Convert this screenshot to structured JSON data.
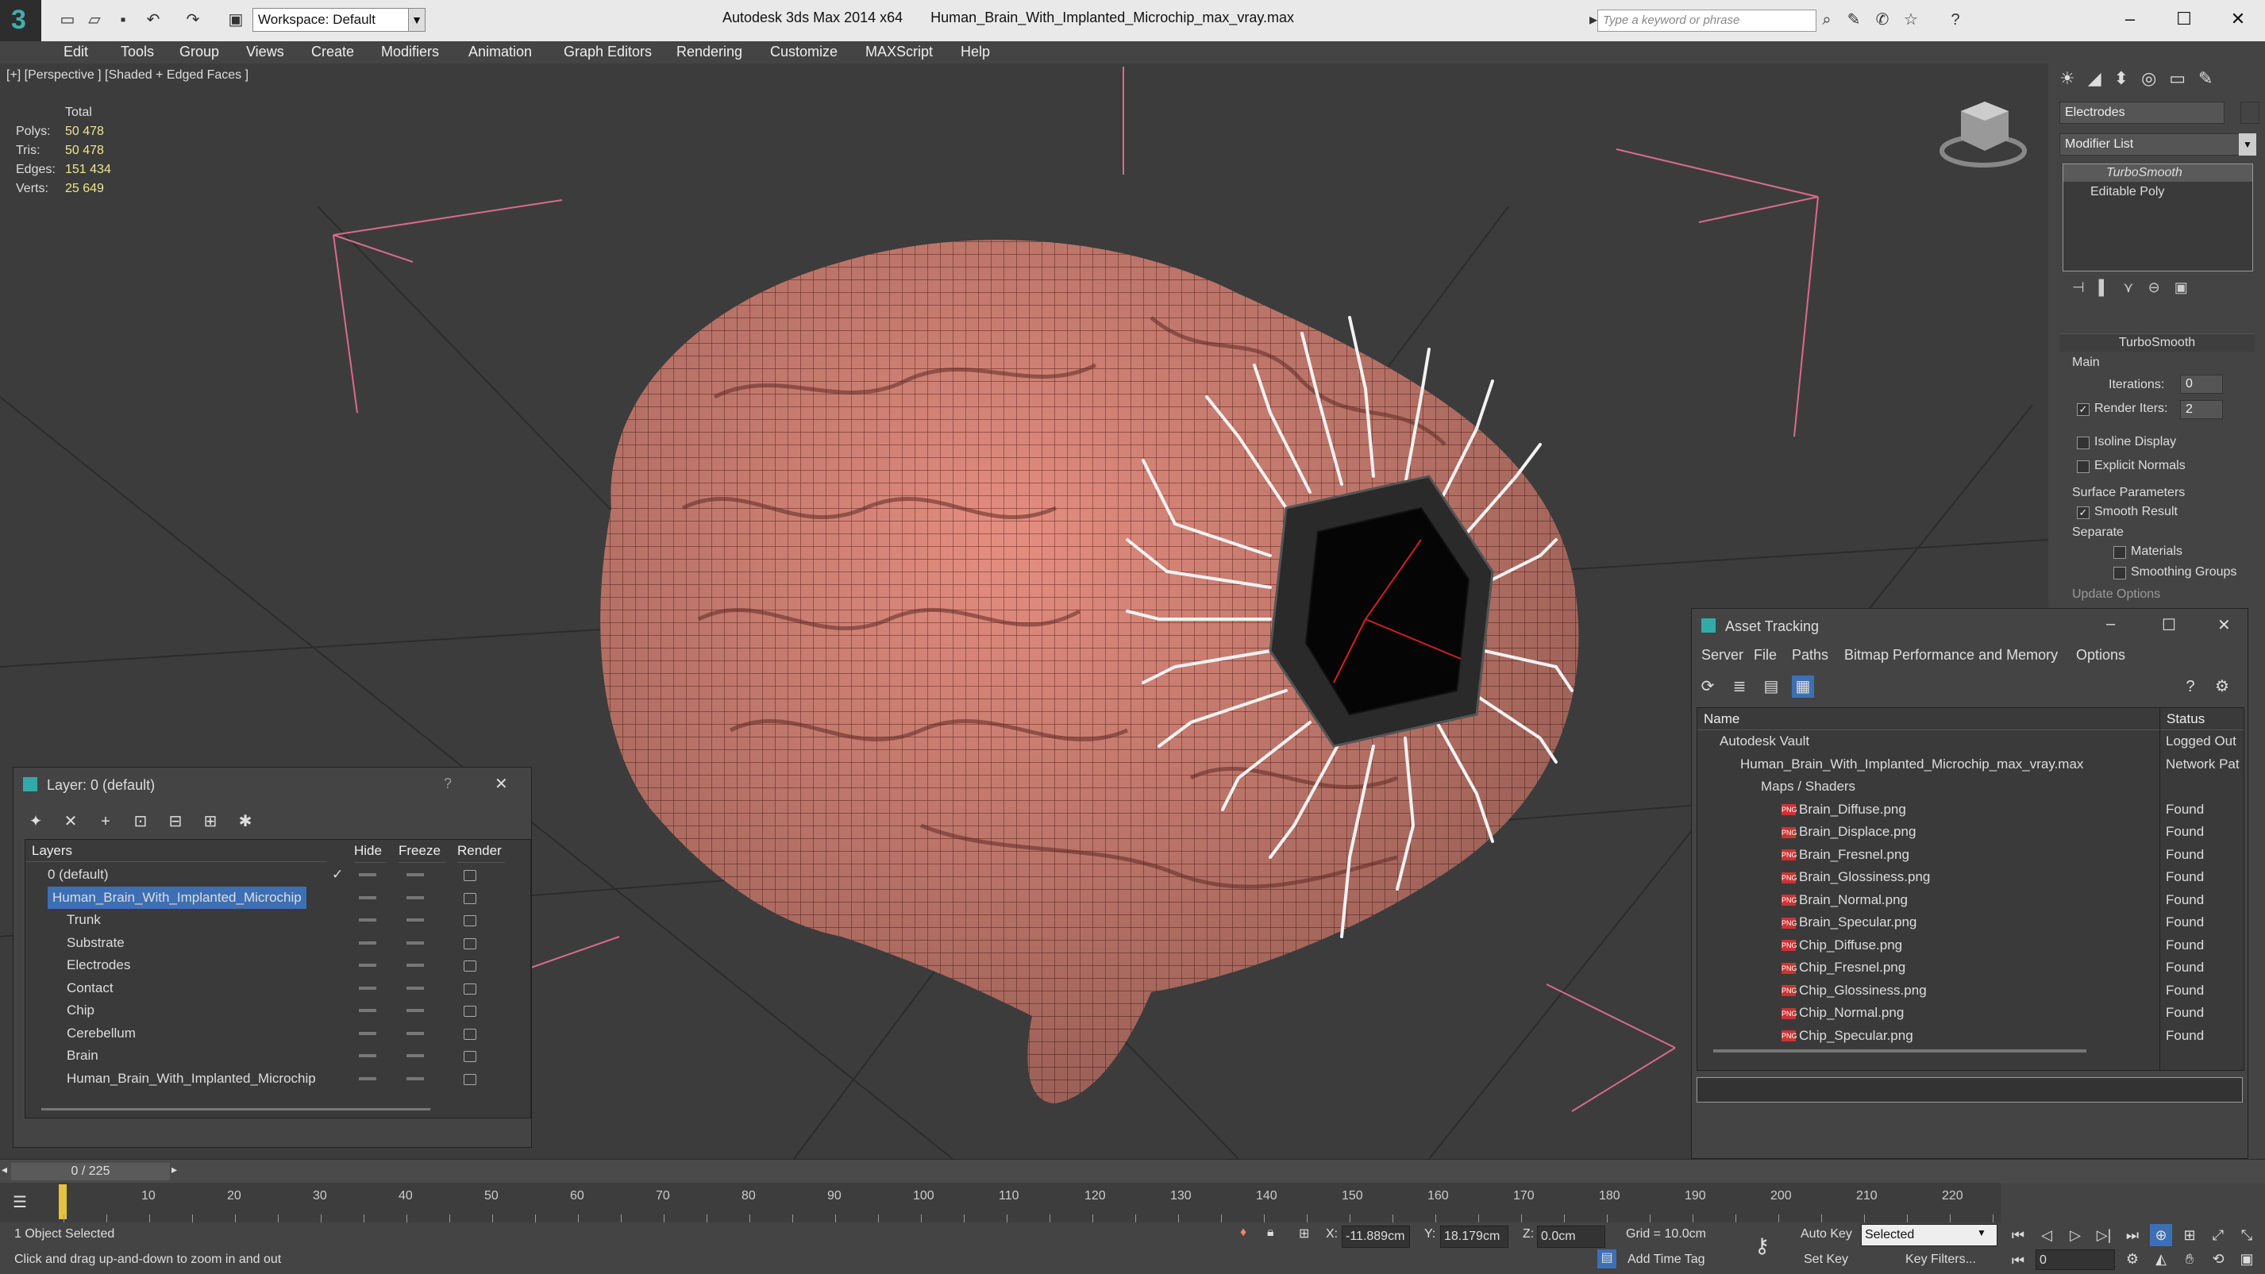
{
  "titlebar": {
    "app_title": "Autodesk 3ds Max  2014 x64",
    "file_name": "Human_Brain_With_Implanted_Microchip_max_vray.max",
    "workspace": "Workspace: Default",
    "search_placeholder": "Type a keyword or phrase"
  },
  "menu": [
    "Edit",
    "Tools",
    "Group",
    "Views",
    "Create",
    "Modifiers",
    "Animation",
    "Graph Editors",
    "Rendering",
    "Customize",
    "MAXScript",
    "Help"
  ],
  "viewport": {
    "label": "[+] [Perspective ] [Shaded + Edged Faces ]",
    "stats": {
      "total_label": "Total",
      "rows": [
        {
          "k": "Polys:",
          "v": "50 478"
        },
        {
          "k": "Tris:",
          "v": "50 478"
        },
        {
          "k": "Edges:",
          "v": "151 434"
        },
        {
          "k": "Verts:",
          "v": "25 649"
        }
      ]
    }
  },
  "command_panel": {
    "object_name": "Electrodes",
    "modifier_list": "Modifier List",
    "stack": [
      "TurboSmooth",
      "Editable Poly"
    ],
    "rollout_title": "TurboSmooth",
    "main_label": "Main",
    "iterations_label": "Iterations:",
    "iterations_value": "0",
    "render_iters_label": "Render Iters:",
    "render_iters_value": "2",
    "isoline": "Isoline Display",
    "explicit": "Explicit Normals",
    "surface_params": "Surface Parameters",
    "smooth_result": "Smooth Result",
    "separate": "Separate",
    "materials": "Materials",
    "smoothing_groups": "Smoothing Groups",
    "update_options": "Update Options"
  },
  "asset_tracking": {
    "title": "Asset Tracking",
    "menu": [
      "Server",
      "File",
      "Paths",
      "Bitmap Performance and Memory",
      "Options"
    ],
    "col_name": "Name",
    "col_status": "Status",
    "rows": [
      {
        "name": "Autodesk Vault",
        "status": "Logged Out",
        "indent": 0,
        "kind": "vault"
      },
      {
        "name": "Human_Brain_With_Implanted_Microchip_max_vray.max",
        "status": "Network Pat",
        "indent": 1,
        "kind": "max"
      },
      {
        "name": "Maps / Shaders",
        "status": "",
        "indent": 2,
        "kind": "folder"
      },
      {
        "name": "Brain_Diffuse.png",
        "status": "Found",
        "indent": 3,
        "kind": "png"
      },
      {
        "name": "Brain_Displace.png",
        "status": "Found",
        "indent": 3,
        "kind": "png"
      },
      {
        "name": "Brain_Fresnel.png",
        "status": "Found",
        "indent": 3,
        "kind": "png"
      },
      {
        "name": "Brain_Glossiness.png",
        "status": "Found",
        "indent": 3,
        "kind": "png"
      },
      {
        "name": "Brain_Normal.png",
        "status": "Found",
        "indent": 3,
        "kind": "png"
      },
      {
        "name": "Brain_Specular.png",
        "status": "Found",
        "indent": 3,
        "kind": "png"
      },
      {
        "name": "Chip_Diffuse.png",
        "status": "Found",
        "indent": 3,
        "kind": "png"
      },
      {
        "name": "Chip_Fresnel.png",
        "status": "Found",
        "indent": 3,
        "kind": "png"
      },
      {
        "name": "Chip_Glossiness.png",
        "status": "Found",
        "indent": 3,
        "kind": "png"
      },
      {
        "name": "Chip_Normal.png",
        "status": "Found",
        "indent": 3,
        "kind": "png"
      },
      {
        "name": "Chip_Specular.png",
        "status": "Found",
        "indent": 3,
        "kind": "png"
      }
    ]
  },
  "layer_dialog": {
    "title": "Layer: 0 (default)",
    "help": "?",
    "col_layers": "Layers",
    "col_hide": "Hide",
    "col_freeze": "Freeze",
    "col_render": "Render",
    "rows": [
      {
        "name": "0 (default)",
        "indent": 0,
        "selected": false,
        "check": true
      },
      {
        "name": "Human_Brain_With_Implanted_Microchip",
        "indent": 0,
        "selected": true,
        "check": false
      },
      {
        "name": "Trunk",
        "indent": 1
      },
      {
        "name": "Substrate",
        "indent": 1
      },
      {
        "name": "Electrodes",
        "indent": 1
      },
      {
        "name": "Contact",
        "indent": 1
      },
      {
        "name": "Chip",
        "indent": 1
      },
      {
        "name": "Cerebellum",
        "indent": 1
      },
      {
        "name": "Brain",
        "indent": 1
      },
      {
        "name": "Human_Brain_With_Implanted_Microchip",
        "indent": 1
      }
    ]
  },
  "timeline": {
    "frame": "0 / 225",
    "ticks": [
      10,
      20,
      30,
      40,
      50,
      60,
      70,
      80,
      90,
      100,
      110,
      120,
      130,
      140,
      150,
      160,
      170,
      180,
      190,
      200,
      210,
      220
    ]
  },
  "status": {
    "selected": "1 Object Selected",
    "hint": "Click and drag up-and-down to zoom in and out",
    "x_label": "X:",
    "x_value": "-11.889cm",
    "y_label": "Y:",
    "y_value": "18.179cm",
    "z_label": "Z:",
    "z_value": "0.0cm",
    "grid": "Grid = 10.0cm",
    "add_time_tag": "Add Time Tag",
    "auto_key": "Auto Key",
    "set_key": "Set Key",
    "selected_dd": "Selected",
    "key_filters": "Key Filters...",
    "frame_field": "0"
  }
}
